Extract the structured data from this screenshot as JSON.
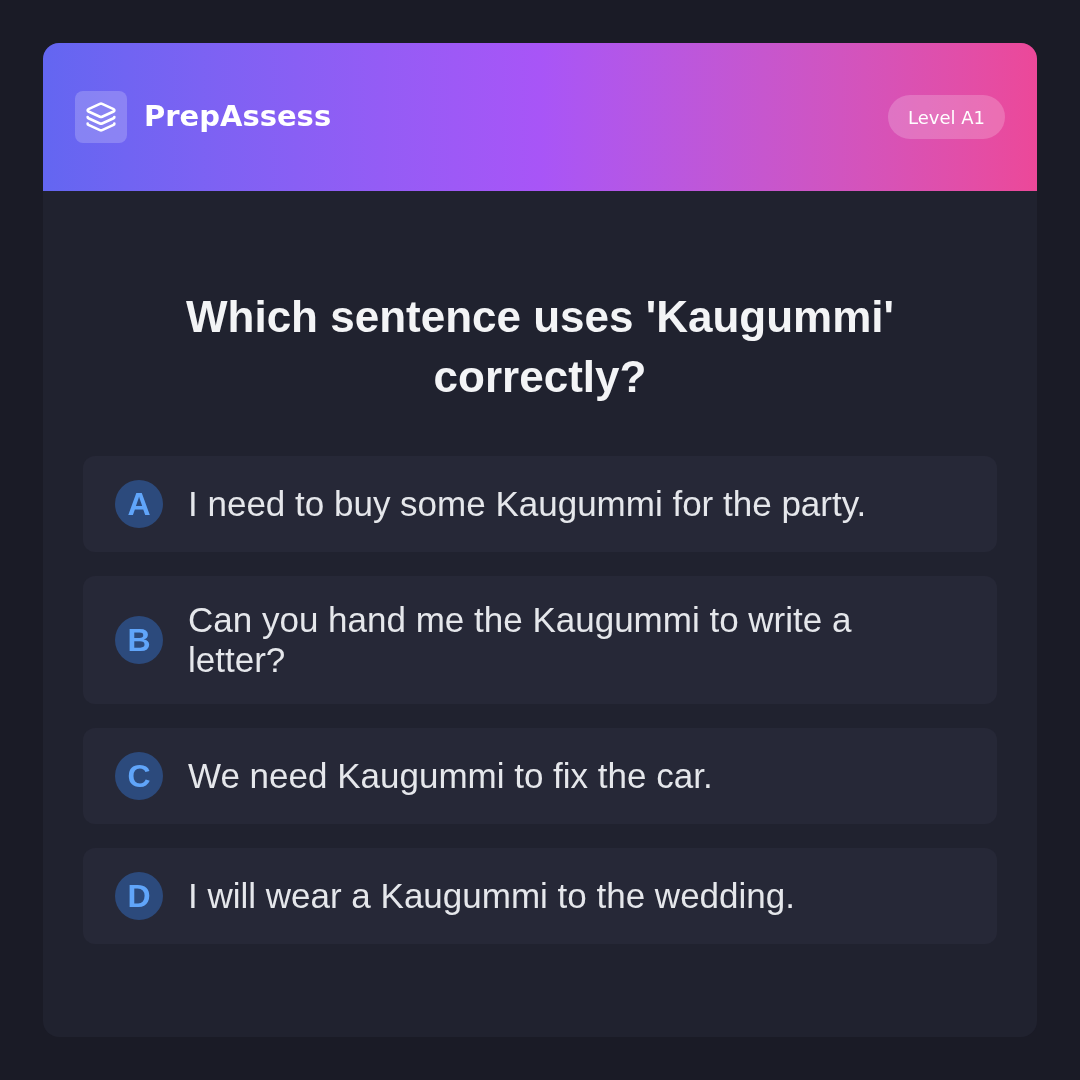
{
  "header": {
    "brand": "PrepAssess",
    "badge": "Level A1"
  },
  "question": "Which sentence uses 'Kaugummi' correctly?",
  "options": [
    {
      "letter": "A",
      "text": "I need to buy some Kaugummi for the party."
    },
    {
      "letter": "B",
      "text": "Can you hand me the Kaugummi to write a letter?"
    },
    {
      "letter": "C",
      "text": "We need Kaugummi to fix the car."
    },
    {
      "letter": "D",
      "text": "I will wear a Kaugummi to the wedding."
    }
  ]
}
